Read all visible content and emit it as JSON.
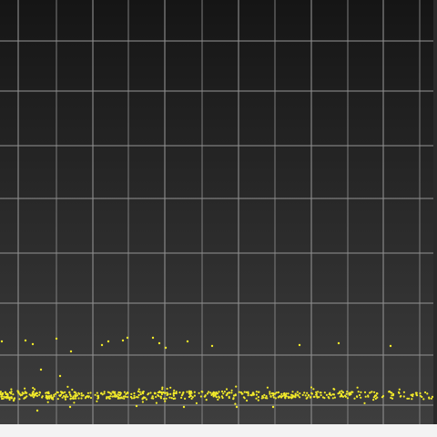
{
  "colors": {
    "background_top": "#151515",
    "background_bottom": "#3e3e3e",
    "grid": "#8f8f8f",
    "point": "#f2ea2a",
    "footer": "#f3f3f3"
  },
  "scatter": {
    "marker": "yellow-dot",
    "grid": true,
    "point_count_visible": "many"
  }
}
